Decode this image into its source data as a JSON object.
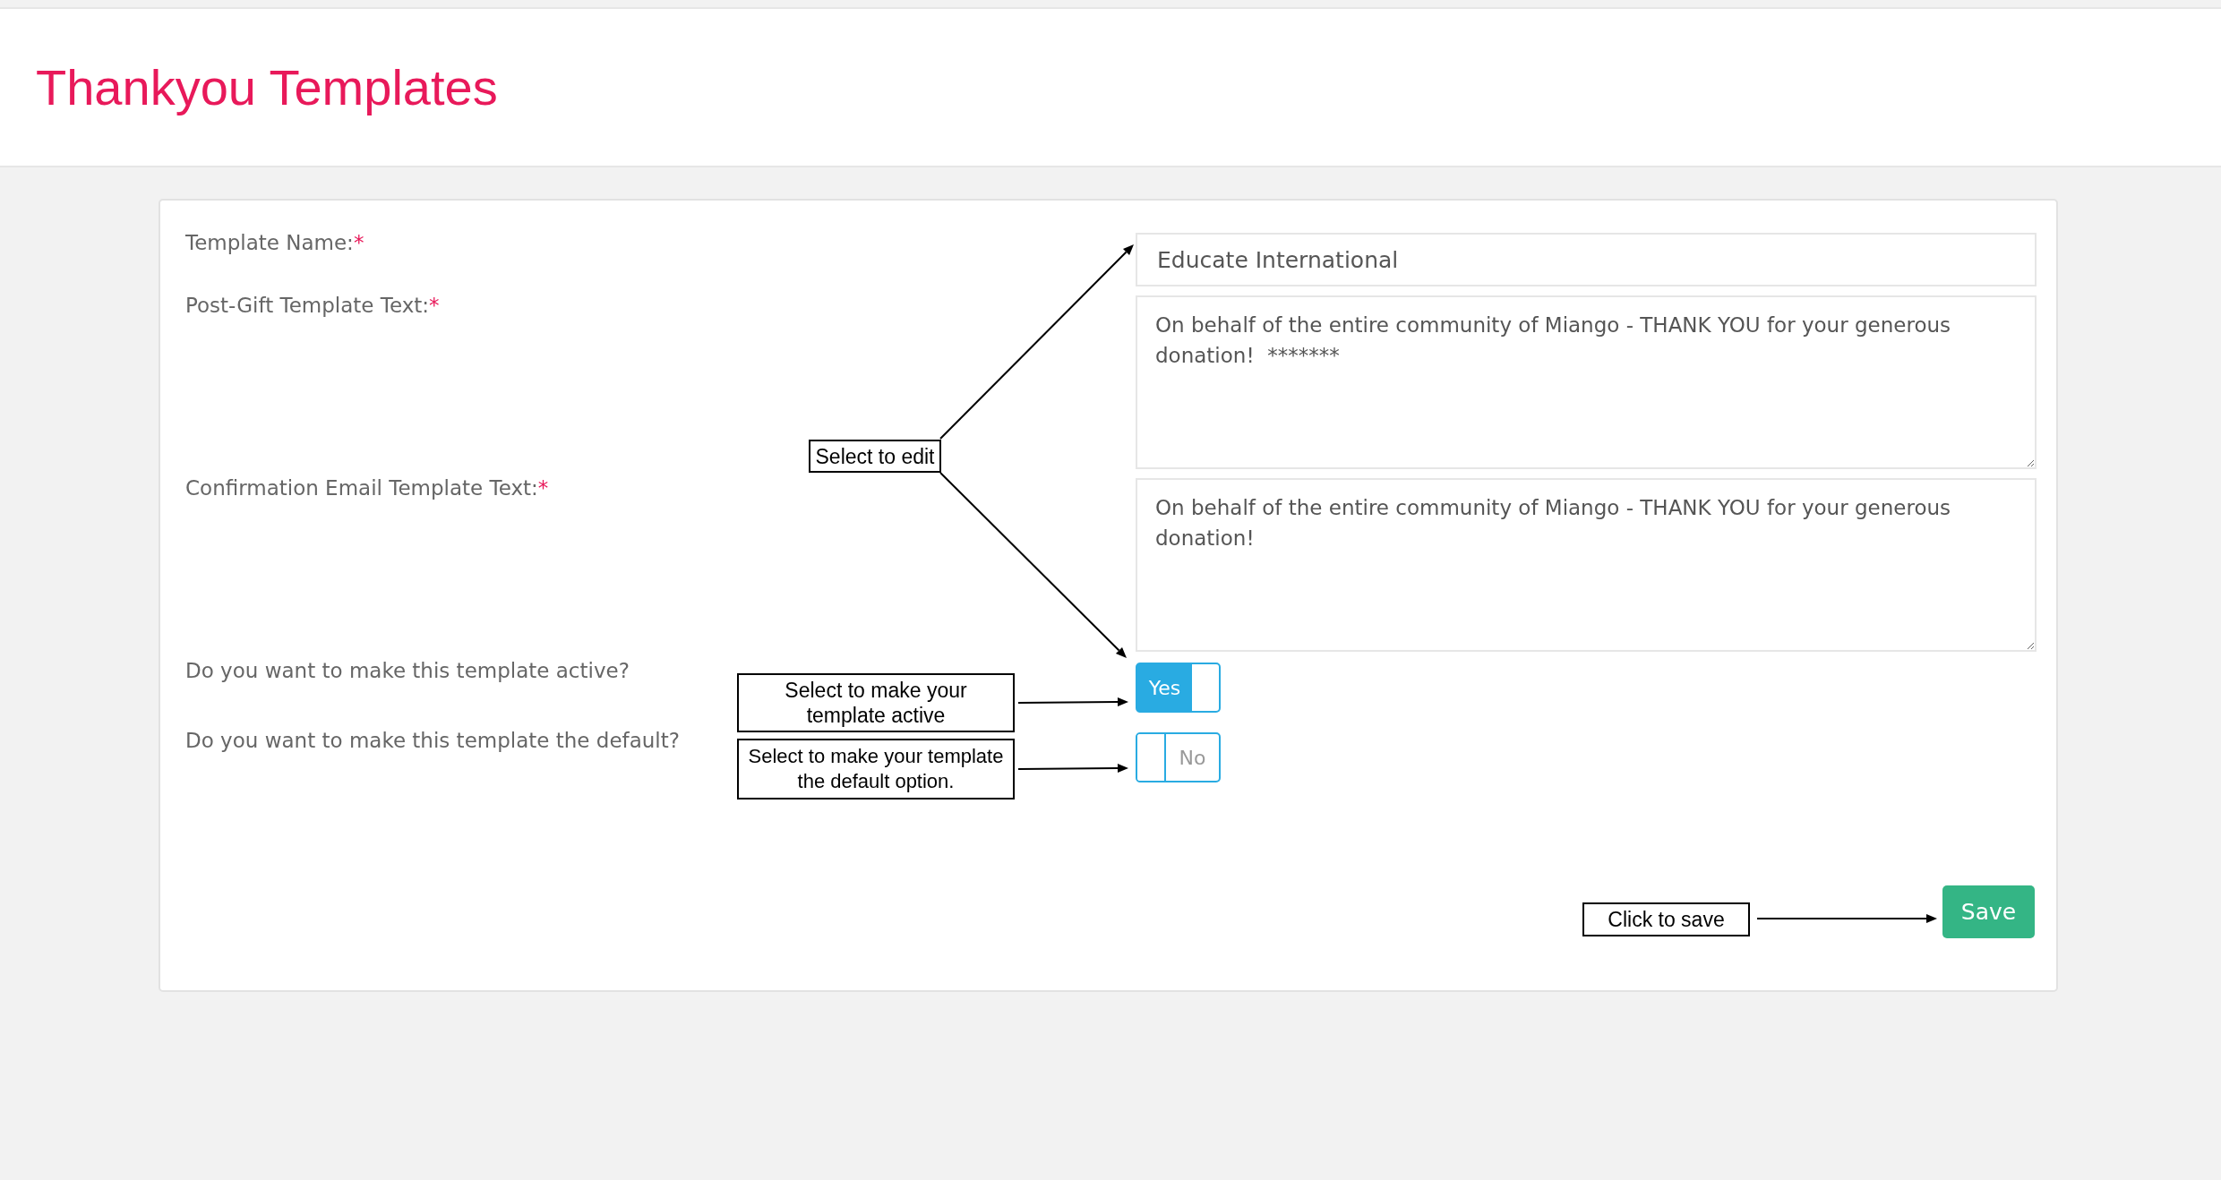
{
  "page": {
    "title": "Thankyou Templates"
  },
  "form": {
    "fields": [
      {
        "kind": "text",
        "label": "Template Name:",
        "required_mark": "*",
        "value": "Educate International"
      },
      {
        "kind": "textarea",
        "label": "Post-Gift Template Text:",
        "required_mark": "*",
        "value": "On behalf of the entire community of Miango - THANK YOU for your generous donation!  *******"
      },
      {
        "kind": "textarea",
        "label": "Confirmation Email Template Text:",
        "required_mark": "*",
        "value": "On behalf of the entire community of Miango - THANK YOU for your generous donation!"
      },
      {
        "kind": "toggle",
        "label": "Do you want to make this template active?",
        "on": true,
        "toggle_label": "Yes"
      },
      {
        "kind": "toggle",
        "label": "Do you want to make this template the default?",
        "on": false,
        "toggle_label": "No"
      }
    ],
    "save_button": "Save"
  },
  "annotations": [
    {
      "text": "Select to edit"
    },
    {
      "text": "Select to make your template active"
    },
    {
      "text": "Select to make your template the default option."
    },
    {
      "text": "Click to save"
    }
  ]
}
